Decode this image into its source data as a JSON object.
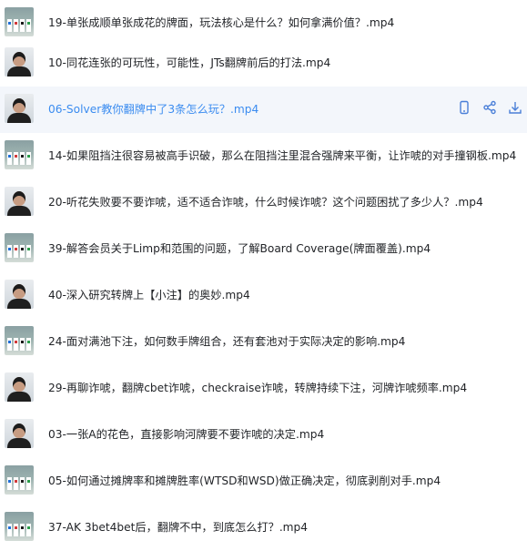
{
  "files": [
    {
      "title": "19-单张成顺单张成花的牌面，玩法核心是什么？如何拿满价值？.mp4",
      "thumb": "cards",
      "hover": false
    },
    {
      "title": "10-同花连张的可玩性，可能性，JTs翻牌前后的打法.mp4",
      "thumb": "person",
      "hover": false
    },
    {
      "title": "06-Solver教你翻牌中了3条怎么玩？.mp4",
      "thumb": "person",
      "hover": true
    },
    {
      "title": "14-如果阻挡注很容易被高手识破，那么在阻挡注里混合强牌来平衡，让诈唬的对手撞钢板.mp4",
      "thumb": "cards",
      "hover": false
    },
    {
      "title": "20-听花失败要不要诈唬，适不适合诈唬，什么时候诈唬？这个问题困扰了多少人？.mp4",
      "thumb": "person",
      "hover": false
    },
    {
      "title": "39-解答会员关于Limp和范围的问题，了解Board Coverage(牌面覆盖).mp4",
      "thumb": "cards",
      "hover": false
    },
    {
      "title": "40-深入研究转牌上【小注】的奥妙.mp4",
      "thumb": "person",
      "hover": false
    },
    {
      "title": "24-面对满池下注，如何数手牌组合，还有套池对于实际决定的影响.mp4",
      "thumb": "cards",
      "hover": false
    },
    {
      "title": "29-再聊诈唬，翻牌cbet诈唬，checkraise诈唬，转牌持续下注，河牌诈唬频率.mp4",
      "thumb": "person",
      "hover": false
    },
    {
      "title": "03-一张A的花色，直接影响河牌要不要诈唬的决定.mp4",
      "thumb": "person",
      "hover": false
    },
    {
      "title": "05-如何通过摊牌率和摊牌胜率(WTSD和WSD)做正确决定，彻底剥削对手.mp4",
      "thumb": "cards",
      "hover": false
    },
    {
      "title": "37-AK 3bet4bet后，翻牌不中，到底怎么打？.mp4",
      "thumb": "cards",
      "hover": false
    }
  ],
  "row_actions": {
    "icons": [
      "phone-icon",
      "share-icon",
      "download-icon"
    ]
  },
  "colors": {
    "hover_background": "#f3f6fb",
    "hover_text": "#3b8cf0",
    "text": "#222428",
    "icon": "#4a7fd8"
  }
}
